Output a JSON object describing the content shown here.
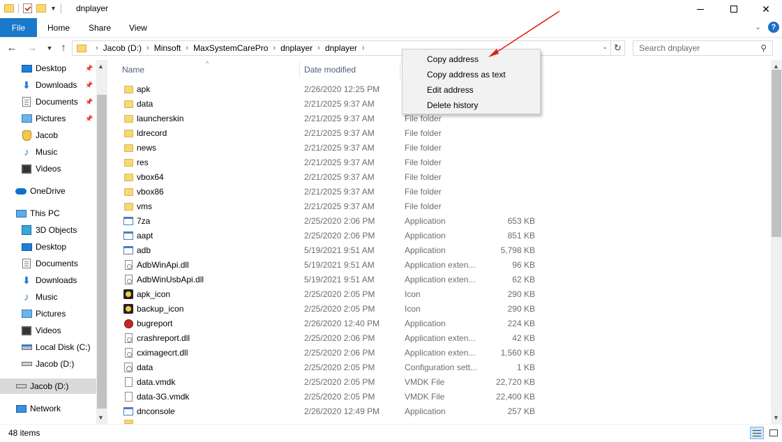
{
  "window": {
    "title": "dnplayer"
  },
  "ribbon": {
    "file": "File",
    "home": "Home",
    "share": "Share",
    "view": "View",
    "help": "?"
  },
  "address": {
    "crumbs": [
      "Jacob (D:)",
      "Minsoft",
      "MaxSystemCarePro",
      "dnplayer",
      "dnplayer"
    ]
  },
  "search": {
    "placeholder": "Search dnplayer"
  },
  "sidebar": {
    "items": [
      {
        "label": "Desktop",
        "icon": "desktop-icon",
        "pinned": true
      },
      {
        "label": "Downloads",
        "icon": "downloads-icon",
        "pinned": true
      },
      {
        "label": "Documents",
        "icon": "documents-icon",
        "pinned": true
      },
      {
        "label": "Pictures",
        "icon": "pictures-icon",
        "pinned": true
      },
      {
        "label": "Jacob",
        "icon": "user-folder-icon",
        "pinned": false
      },
      {
        "label": "Music",
        "icon": "music-icon",
        "pinned": false
      },
      {
        "label": "Videos",
        "icon": "videos-icon",
        "pinned": false
      },
      {
        "label": "OneDrive",
        "icon": "onedrive-icon",
        "pinned": false
      },
      {
        "label": "This PC",
        "icon": "this-pc-icon",
        "pinned": false
      },
      {
        "label": "3D Objects",
        "icon": "3d-objects-icon",
        "pinned": false
      },
      {
        "label": "Desktop",
        "icon": "desktop-icon",
        "pinned": false
      },
      {
        "label": "Documents",
        "icon": "documents-icon",
        "pinned": false
      },
      {
        "label": "Downloads",
        "icon": "downloads-icon",
        "pinned": false
      },
      {
        "label": "Music",
        "icon": "music-icon",
        "pinned": false
      },
      {
        "label": "Pictures",
        "icon": "pictures-icon",
        "pinned": false
      },
      {
        "label": "Videos",
        "icon": "videos-icon",
        "pinned": false
      },
      {
        "label": "Local Disk (C:)",
        "icon": "local-disk-icon",
        "pinned": false
      },
      {
        "label": "Jacob (D:)",
        "icon": "drive-icon",
        "pinned": false
      },
      {
        "label": "Jacob (D:)",
        "icon": "drive-icon",
        "pinned": false,
        "selected": true
      },
      {
        "label": "Network",
        "icon": "network-icon",
        "pinned": false
      }
    ]
  },
  "columns": {
    "name": "Name",
    "date": "Date modified"
  },
  "files": [
    {
      "name": "apk",
      "date": "2/26/2020 12:25 PM",
      "type": "",
      "size": "",
      "icon": "folder-icon"
    },
    {
      "name": "data",
      "date": "2/21/2025 9:37 AM",
      "type": "",
      "size": "",
      "icon": "folder-icon"
    },
    {
      "name": "launcherskin",
      "date": "2/21/2025 9:37 AM",
      "type": "File folder",
      "size": "",
      "icon": "folder-icon"
    },
    {
      "name": "ldrecord",
      "date": "2/21/2025 9:37 AM",
      "type": "File folder",
      "size": "",
      "icon": "folder-icon"
    },
    {
      "name": "news",
      "date": "2/21/2025 9:37 AM",
      "type": "File folder",
      "size": "",
      "icon": "folder-icon"
    },
    {
      "name": "res",
      "date": "2/21/2025 9:37 AM",
      "type": "File folder",
      "size": "",
      "icon": "folder-icon"
    },
    {
      "name": "vbox64",
      "date": "2/21/2025 9:37 AM",
      "type": "File folder",
      "size": "",
      "icon": "folder-icon"
    },
    {
      "name": "vbox86",
      "date": "2/21/2025 9:37 AM",
      "type": "File folder",
      "size": "",
      "icon": "folder-icon"
    },
    {
      "name": "vms",
      "date": "2/21/2025 9:37 AM",
      "type": "File folder",
      "size": "",
      "icon": "folder-icon"
    },
    {
      "name": "7za",
      "date": "2/25/2020 2:06 PM",
      "type": "Application",
      "size": "653 KB",
      "icon": "app-icon"
    },
    {
      "name": "aapt",
      "date": "2/25/2020 2:06 PM",
      "type": "Application",
      "size": "851 KB",
      "icon": "app-icon"
    },
    {
      "name": "adb",
      "date": "5/19/2021 9:51 AM",
      "type": "Application",
      "size": "5,798 KB",
      "icon": "app-icon"
    },
    {
      "name": "AdbWinApi.dll",
      "date": "5/19/2021 9:51 AM",
      "type": "Application exten...",
      "size": "96 KB",
      "icon": "dll-icon"
    },
    {
      "name": "AdbWinUsbApi.dll",
      "date": "5/19/2021 9:51 AM",
      "type": "Application exten...",
      "size": "62 KB",
      "icon": "dll-icon"
    },
    {
      "name": "apk_icon",
      "date": "2/25/2020 2:05 PM",
      "type": "Icon",
      "size": "290 KB",
      "icon": "image-icon"
    },
    {
      "name": "backup_icon",
      "date": "2/25/2020 2:05 PM",
      "type": "Icon",
      "size": "290 KB",
      "icon": "image-icon"
    },
    {
      "name": "bugreport",
      "date": "2/26/2020 12:40 PM",
      "type": "Application",
      "size": "224 KB",
      "icon": "bug-icon"
    },
    {
      "name": "crashreport.dll",
      "date": "2/25/2020 2:06 PM",
      "type": "Application exten...",
      "size": "42 KB",
      "icon": "dll-icon"
    },
    {
      "name": "cximagecrt.dll",
      "date": "2/25/2020 2:06 PM",
      "type": "Application exten...",
      "size": "1,560 KB",
      "icon": "dll-icon"
    },
    {
      "name": "data",
      "date": "2/25/2020 2:05 PM",
      "type": "Configuration sett...",
      "size": "1 KB",
      "icon": "config-icon"
    },
    {
      "name": "data.vmdk",
      "date": "2/25/2020 2:05 PM",
      "type": "VMDK File",
      "size": "22,720 KB",
      "icon": "file-icon"
    },
    {
      "name": "data-3G.vmdk",
      "date": "2/25/2020 2:05 PM",
      "type": "VMDK File",
      "size": "22,400 KB",
      "icon": "file-icon"
    },
    {
      "name": "dnconsole",
      "date": "2/26/2020 12:49 PM",
      "type": "Application",
      "size": "257 KB",
      "icon": "app-icon"
    }
  ],
  "context_menu": {
    "items": [
      "Copy address",
      "Copy address as text",
      "Edit address",
      "Delete history"
    ]
  },
  "status": {
    "count": "48 items"
  },
  "colors": {
    "accent": "#1979ca",
    "annotation": "#e0201b"
  }
}
